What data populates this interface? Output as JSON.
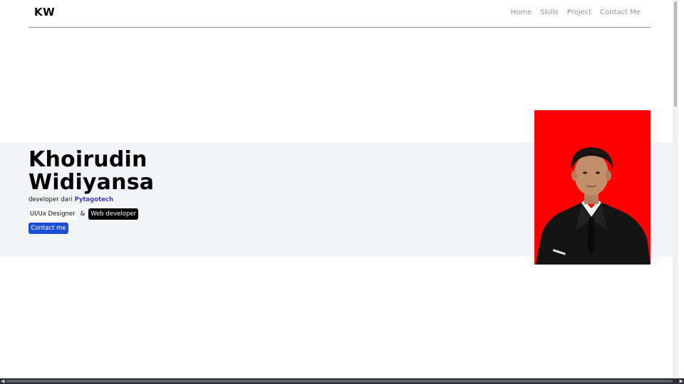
{
  "navbar": {
    "brand": "KW",
    "links": [
      "Home",
      "Skills",
      "Project",
      "Contact Me"
    ]
  },
  "hero": {
    "name_line1": "Khoirudin",
    "name_line2": "Widiyansa",
    "subtitle_prefix": "developer dari ",
    "company": "Pytagotech",
    "role1": "UI/Ux Designer",
    "ampersand": "&",
    "role2": "Web developer",
    "cta": "Contact me"
  },
  "photo": {
    "background_color": "#ff0000"
  },
  "colors": {
    "accent": "#1d4ed8",
    "company_text": "#4338ca",
    "hero_band": "#f3f4f6"
  },
  "icons": {
    "scroll_left": "scroll-left-arrow-icon",
    "scroll_right": "scroll-right-arrow-icon"
  }
}
